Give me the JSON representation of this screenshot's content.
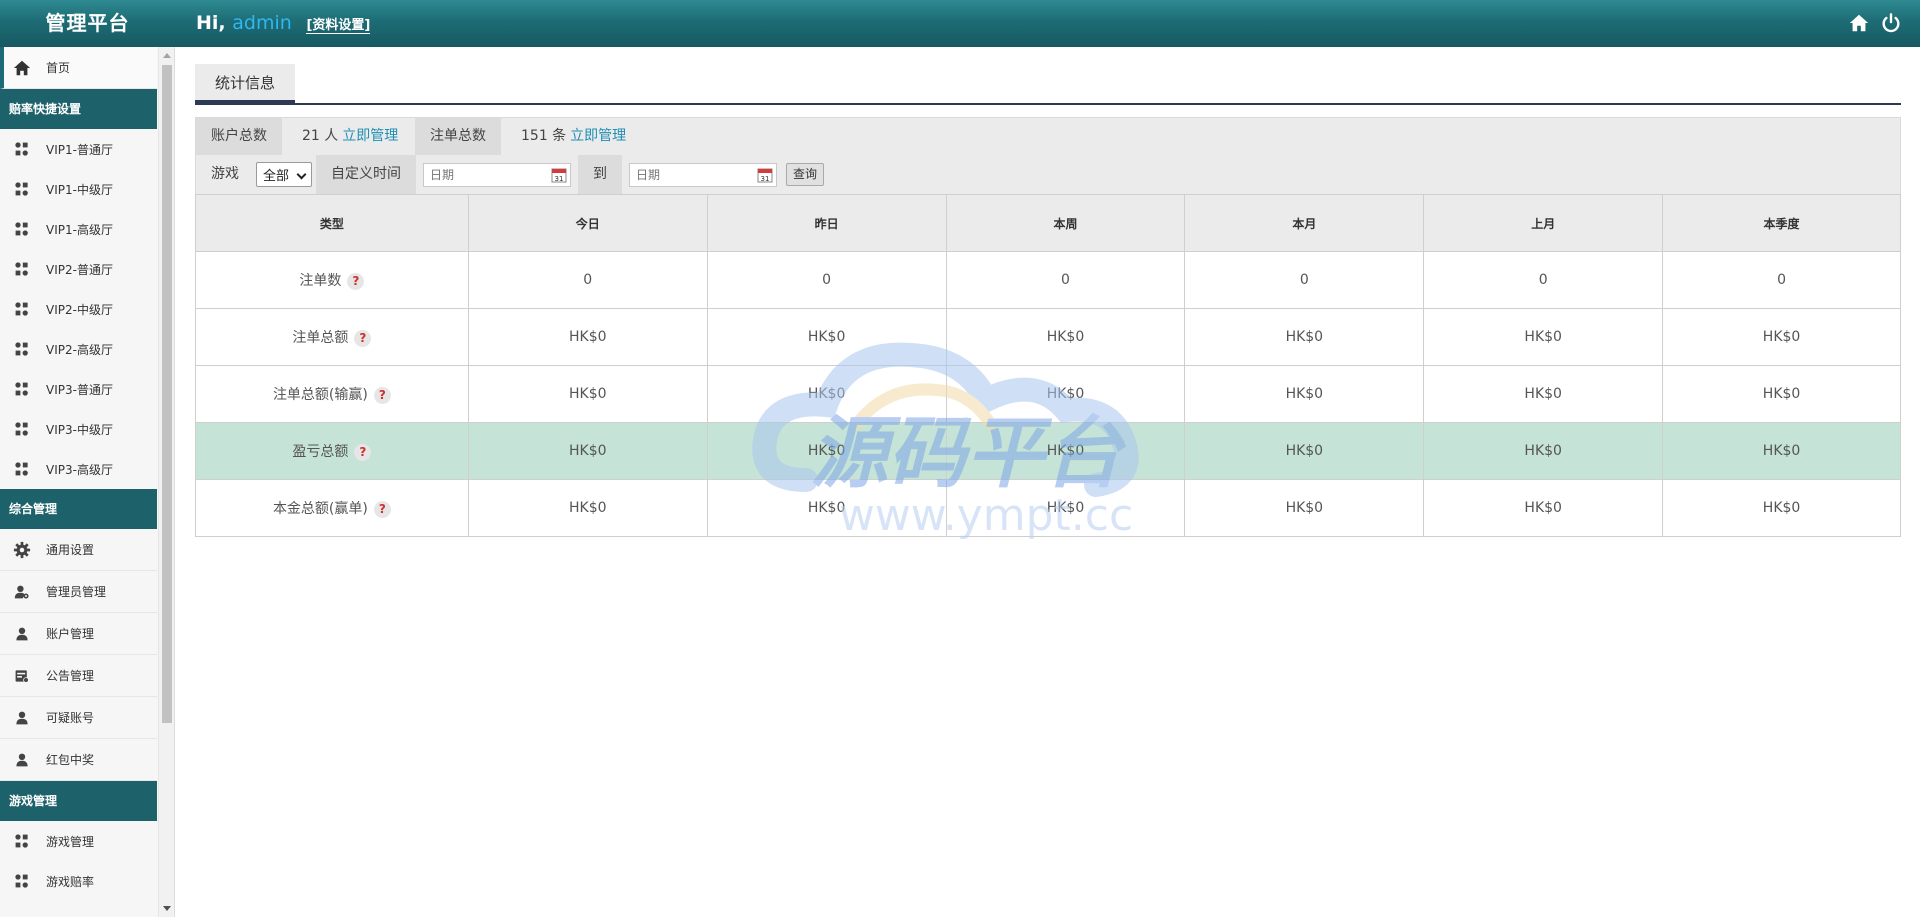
{
  "topbar": {
    "brand": "管理平台",
    "greeting_prefix": "Hi,",
    "username": "admin",
    "profile_link": "[资料设置]",
    "colors": {
      "bar": "#1d6c75",
      "username": "#2fb8f0"
    }
  },
  "sidebar": {
    "home_label": "首页",
    "sections": [
      {
        "title": "赔率快捷设置",
        "items": [
          "VIP1-普通厅",
          "VIP1-中级厅",
          "VIP1-高级厅",
          "VIP2-普通厅",
          "VIP2-中级厅",
          "VIP2-高级厅",
          "VIP3-普通厅",
          "VIP3-中级厅",
          "VIP3-高级厅"
        ]
      },
      {
        "title": "综合管理",
        "items": [
          "通用设置",
          "管理员管理",
          "账户管理",
          "公告管理",
          "可疑账号",
          "红包中奖"
        ]
      },
      {
        "title": "游戏管理",
        "items": [
          "游戏管理",
          "游戏赔率"
        ]
      }
    ],
    "colors": {
      "header": "#1d626a"
    }
  },
  "main": {
    "tab": "统计信息",
    "summary": {
      "accounts_label": "账户总数",
      "accounts_value": "21 人",
      "accounts_link": "立即管理",
      "bets_label": "注单总数",
      "bets_value": "151 条",
      "bets_link": "立即管理"
    },
    "filter": {
      "game_label": "游戏",
      "game_selected": "全部",
      "custom_time_label": "自定义时间",
      "date_placeholder_from": "日期",
      "to_label": "到",
      "date_placeholder_to": "日期",
      "query_button": "查询"
    },
    "table": {
      "columns": [
        "类型",
        "今日",
        "昨日",
        "本周",
        "本月",
        "上月",
        "本季度"
      ],
      "rows": [
        {
          "label": "注单数",
          "values": [
            "0",
            "0",
            "0",
            "0",
            "0",
            "0"
          ]
        },
        {
          "label": "注单总额",
          "values": [
            "HK$0",
            "HK$0",
            "HK$0",
            "HK$0",
            "HK$0",
            "HK$0"
          ]
        },
        {
          "label": "注单总额(输赢)",
          "values": [
            "HK$0",
            "HK$0",
            "HK$0",
            "HK$0",
            "HK$0",
            "HK$0"
          ]
        },
        {
          "label": "盈亏总额",
          "values": [
            "HK$0",
            "HK$0",
            "HK$0",
            "HK$0",
            "HK$0",
            "HK$0"
          ],
          "highlight": true
        },
        {
          "label": "本金总额(赢单)",
          "values": [
            "HK$0",
            "HK$0",
            "HK$0",
            "HK$0",
            "HK$0",
            "HK$0"
          ]
        }
      ],
      "help_mark": "?",
      "colors": {
        "highlight_row": "#c5e3d6",
        "help": "#d03030"
      }
    },
    "watermark": {
      "title": "源码平台",
      "url": "www.ympt.cc"
    }
  }
}
